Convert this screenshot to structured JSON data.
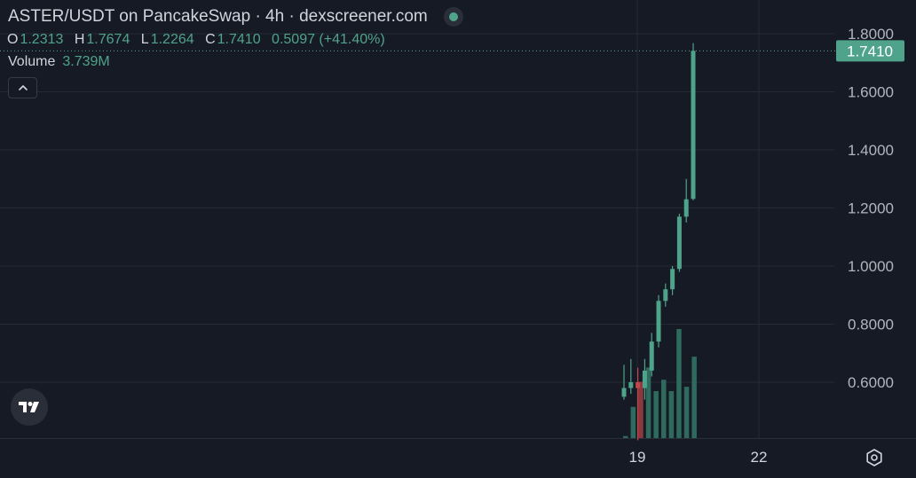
{
  "header": {
    "title": "ASTER/USDT on PancakeSwap · 4h · dexscreener.com",
    "status_icon": "live-dot-icon"
  },
  "ohlc": {
    "o_label": "O",
    "o_value": "1.2313",
    "h_label": "H",
    "h_value": "1.7674",
    "l_label": "L",
    "l_value": "1.2264",
    "c_label": "C",
    "c_value": "1.7410",
    "change": "0.5097 (+41.40%)"
  },
  "volume": {
    "label": "Volume",
    "value": "3.739M"
  },
  "controls": {
    "collapse_icon": "chevron-up-icon",
    "logo_icon": "tradingview-logo-icon",
    "settings_icon": "gear-icon"
  },
  "colors": {
    "background": "#161a25",
    "grid": "#262a35",
    "up": "#4fa38a",
    "down": "#c2464c",
    "text": "#d1d4dc",
    "axis_text": "#b2b5be"
  },
  "chart_data": {
    "type": "candlestick",
    "ylim": [
      0.48,
      1.84
    ],
    "y_ticks": [
      "1.8000",
      "1.6000",
      "1.4000",
      "1.2000",
      "1.0000",
      "0.8000",
      "0.6000"
    ],
    "y_tick_values": [
      1.8,
      1.6,
      1.4,
      1.2,
      1.0,
      0.8,
      0.6
    ],
    "x_tick_labels": [
      "19",
      "22"
    ],
    "last_price_label": "1.7410",
    "last_price": 1.741,
    "candles": [
      {
        "o": 0.55,
        "h": 0.66,
        "l": 0.54,
        "c": 0.58
      },
      {
        "o": 0.58,
        "h": 0.68,
        "l": 0.56,
        "c": 0.6
      },
      {
        "o": 0.6,
        "h": 0.65,
        "l": 0.4,
        "c": 0.58
      },
      {
        "o": 0.58,
        "h": 0.68,
        "l": 0.54,
        "c": 0.64
      },
      {
        "o": 0.64,
        "h": 0.77,
        "l": 0.62,
        "c": 0.74
      },
      {
        "o": 0.74,
        "h": 0.9,
        "l": 0.72,
        "c": 0.88
      },
      {
        "o": 0.88,
        "h": 0.94,
        "l": 0.86,
        "c": 0.92
      },
      {
        "o": 0.92,
        "h": 1.0,
        "l": 0.9,
        "c": 0.99
      },
      {
        "o": 0.99,
        "h": 1.18,
        "l": 0.98,
        "c": 1.17
      },
      {
        "o": 1.17,
        "h": 1.3,
        "l": 1.15,
        "c": 1.23
      },
      {
        "o": 1.2313,
        "h": 1.7674,
        "l": 1.2264,
        "c": 1.741
      }
    ],
    "volume_max": 3.739,
    "volumes": [
      {
        "v": 0.07,
        "dir": "up"
      },
      {
        "v": 1.07,
        "dir": "up"
      },
      {
        "v": 1.93,
        "dir": "down"
      },
      {
        "v": 2.42,
        "dir": "up"
      },
      {
        "v": 1.61,
        "dir": "up"
      },
      {
        "v": 2.0,
        "dir": "up"
      },
      {
        "v": 1.61,
        "dir": "up"
      },
      {
        "v": 3.74,
        "dir": "up"
      },
      {
        "v": 1.76,
        "dir": "up"
      },
      {
        "v": 2.79,
        "dir": "up"
      }
    ]
  }
}
